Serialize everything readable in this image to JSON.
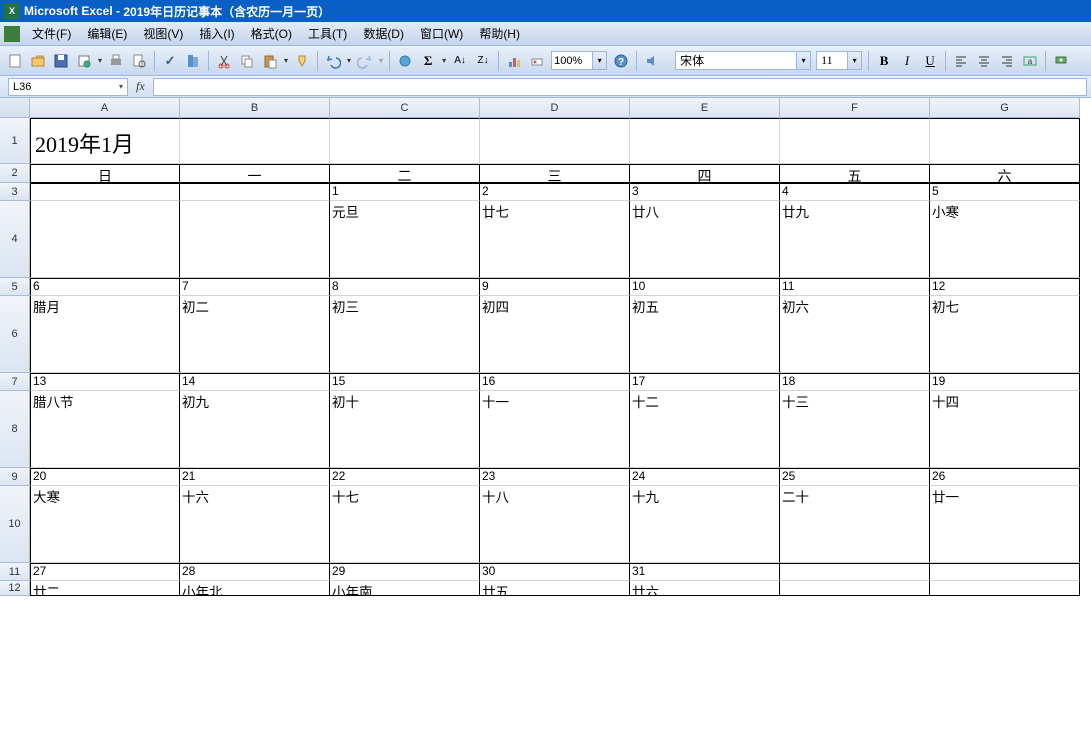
{
  "titlebar": {
    "app": "Microsoft Excel",
    "doc": "2019年日历记事本（含农历一月一页）"
  },
  "menubar": {
    "file": "文件(F)",
    "edit": "编辑(E)",
    "view": "视图(V)",
    "insert": "插入(I)",
    "format": "格式(O)",
    "tools": "工具(T)",
    "data": "数据(D)",
    "window": "窗口(W)",
    "help": "帮助(H)"
  },
  "toolbar": {
    "zoom": "100%",
    "font_name": "宋体",
    "font_size": "11"
  },
  "namebox": {
    "ref": "L36"
  },
  "colHeaders": [
    "A",
    "B",
    "C",
    "D",
    "E",
    "F",
    "G"
  ],
  "rowHeaders": [
    "1",
    "2",
    "3",
    "4",
    "5",
    "6",
    "7",
    "8",
    "9",
    "10",
    "11",
    "12"
  ],
  "calendar": {
    "title": "2019年1月",
    "dow": [
      "日",
      "一",
      "二",
      "三",
      "四",
      "五",
      "六"
    ],
    "weeks": [
      {
        "nums": [
          "",
          "",
          "1",
          "2",
          "3",
          "4",
          "5"
        ],
        "lunars": [
          "",
          "",
          "元旦",
          "廿七",
          "廿八",
          "廿九",
          "小寒"
        ]
      },
      {
        "nums": [
          "6",
          "7",
          "8",
          "9",
          "10",
          "11",
          "12"
        ],
        "lunars": [
          "腊月",
          "初二",
          "初三",
          "初四",
          "初五",
          "初六",
          "初七"
        ]
      },
      {
        "nums": [
          "13",
          "14",
          "15",
          "16",
          "17",
          "18",
          "19"
        ],
        "lunars": [
          "腊八节",
          "初九",
          "初十",
          "十一",
          "十二",
          "十三",
          "十四"
        ]
      },
      {
        "nums": [
          "20",
          "21",
          "22",
          "23",
          "24",
          "25",
          "26"
        ],
        "lunars": [
          "大寒",
          "十六",
          "十七",
          "十八",
          "十九",
          "二十",
          "廿一"
        ]
      },
      {
        "nums": [
          "27",
          "28",
          "29",
          "30",
          "31",
          "",
          ""
        ],
        "lunars": [
          "廿二",
          "小年北",
          "小年南",
          "廿五",
          "廿六",
          "",
          ""
        ]
      }
    ]
  }
}
